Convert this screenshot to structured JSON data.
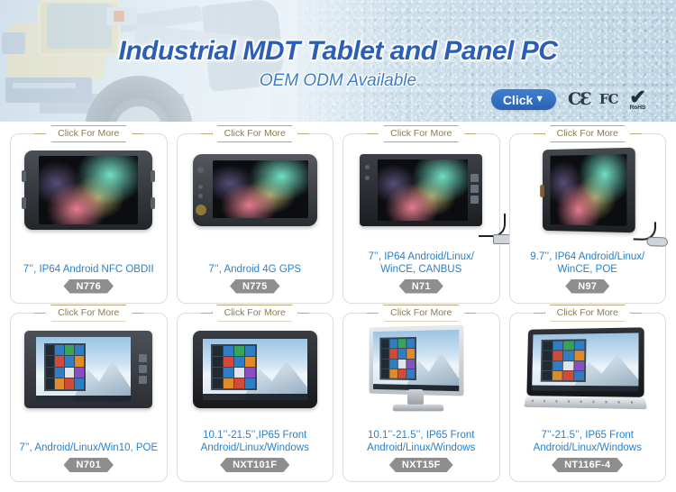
{
  "banner": {
    "title": "Industrial MDT Tablet and Panel PC",
    "subtitle": "OEM ODM Available",
    "click_button": {
      "label": "Click",
      "caret": "▼"
    },
    "certifications": [
      {
        "name": "ce-mark",
        "label": "CƐ"
      },
      {
        "name": "fcc-mark",
        "label": "FC"
      },
      {
        "name": "rohs-mark",
        "label": "RoHS",
        "check": "✔"
      }
    ],
    "colors": {
      "title": "#2a5fb8",
      "subtitle": "#3f7ec4",
      "button": "#2a62b4"
    }
  },
  "ribbon_label": "Click For More",
  "products": [
    {
      "caption": "7’’, IP64 Android NFC OBDII",
      "code": "N776",
      "art": "n776"
    },
    {
      "caption": "7’’, Android 4G GPS",
      "code": "N775",
      "art": "n775"
    },
    {
      "caption": "7’’, IP64 Android/Linux/\nWinCE, CANBUS",
      "code": "N71",
      "art": "n71"
    },
    {
      "caption": "9.7’’, IP64 Android/Linux/\nWinCE, POE",
      "code": "N97",
      "art": "n97"
    },
    {
      "caption": "7’’, Android/Linux/Win10, POE",
      "code": "N701",
      "art": "n701"
    },
    {
      "caption": "10.1’’-21.5’’,IP65 Front\nAndroid/Linux/Windows",
      "code": "NXT101F",
      "art": "nxt101f"
    },
    {
      "caption": "10.1’’-21.5’’, IP65 Front\nAndroid/Linux/Windows",
      "code": "NXT15F",
      "art": "nxt15f"
    },
    {
      "caption": "7’’-21.5’’, IP65 Front\nAndroid/Linux/Windows",
      "code": "NT116F-4",
      "art": "nt116f4"
    }
  ],
  "colors": {
    "caption": "#2a81cc",
    "badge": "#8e8e8e",
    "ribbon_border": "#bda877",
    "ribbon_text": "#8e7b50",
    "card_border": "#dcdcdc"
  }
}
